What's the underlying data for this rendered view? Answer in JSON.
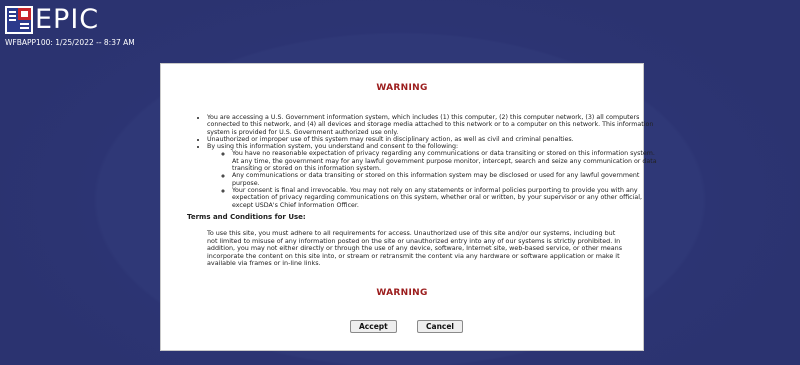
{
  "header": {
    "app_name": "EPIC",
    "server_info": "WFBAPP100: 1/25/2022 -- 8:37 AM",
    "logo_colors": {
      "blue": "#2b3a8c",
      "red": "#c8252c",
      "white": "#ffffff"
    }
  },
  "dialog": {
    "warning_title_top": "WARNING",
    "warning_title_bottom": "WARNING",
    "bullets": [
      "You are accessing a U.S. Government information system, which includes (1) this computer, (2) this computer network, (3) all computers connected to this network, and (4) all devices and storage media attached to this network or to a computer on this network. This information system is provided for U.S. Government authorized use only.",
      "Unauthorized or improper use of this system may result in disciplinary action, as well as civil and criminal penalties.",
      "By using this information system, you understand and consent to the following:"
    ],
    "sub_bullets": [
      "You have no reasonable expectation of privacy regarding any communications or data transiting or stored on this information system. At any time, the government may for any lawful government purpose monitor, intercept, search and seize any communication or data transiting or stored on this information system.",
      "Any communications or data transiting or stored on this information system may be disclosed or used for any lawful government purpose.",
      "Your consent is final and irrevocable. You may not rely on any statements or informal policies purporting to provide you with any expectation of privacy regarding communications on this system, whether oral or written, by your supervisor or any other official, except USDA's Chief Information Officer."
    ],
    "terms_heading": "Terms and Conditions for Use:",
    "terms_body": "To use this site, you must adhere to all requirements for access. Unauthorized use of this site and/or our systems, including but not limited to misuse of any information posted on the site or unauthorized entry into any of our systems is strictly prohibited. In addition, you may not either directly or through the use of any device, software, Internet site, web-based service, or other means incorporate the content on this site into, or stream or retransmit the content via any hardware or software application or make it available via frames or in-line links.",
    "accept_label": "Accept",
    "cancel_label": "Cancel"
  },
  "colors": {
    "background": "#2e3772",
    "warning_text": "#9b1c1c",
    "panel": "#ffffff"
  }
}
